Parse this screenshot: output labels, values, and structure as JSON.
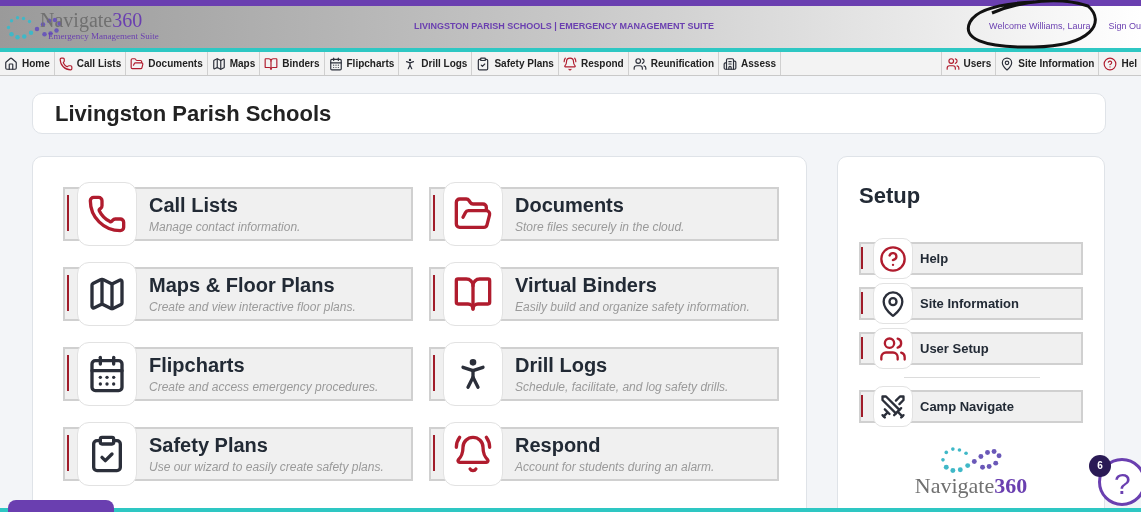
{
  "header": {
    "logo_text": "Navigate",
    "logo_number": "360",
    "logo_subtitle": "Emergency Management Suite",
    "title": "LIVINGSTON PARISH SCHOOLS | EMERGENCY MANAGEMENT SUITE",
    "welcome": "Welcome Williams, Laura",
    "sign_out": "Sign Ou"
  },
  "nav_left": [
    {
      "label": "Home",
      "kind": "home"
    },
    {
      "label": "Call Lists",
      "kind": "calllist"
    },
    {
      "label": "Documents",
      "kind": "documents"
    },
    {
      "label": "Maps",
      "kind": "maps"
    },
    {
      "label": "Binders",
      "kind": "binders"
    },
    {
      "label": "Flipcharts",
      "kind": "flipcharts"
    },
    {
      "label": "Drill Logs",
      "kind": "drill"
    },
    {
      "label": "Safety Plans",
      "kind": "safety"
    },
    {
      "label": "Respond",
      "kind": "respond"
    },
    {
      "label": "Reunification",
      "kind": "reunification"
    },
    {
      "label": "Assess",
      "kind": "assess"
    }
  ],
  "nav_right": [
    {
      "label": "Users",
      "kind": "users"
    },
    {
      "label": "Site Information",
      "kind": "site"
    },
    {
      "label": "Hel",
      "kind": "help"
    }
  ],
  "page_title": "Livingston Parish Schools",
  "modules": [
    {
      "title": "Call Lists",
      "description": "Manage contact information.",
      "kind": "calllist"
    },
    {
      "title": "Documents",
      "description": "Store files securely in the cloud.",
      "kind": "documents"
    },
    {
      "title": "Maps & Floor Plans",
      "description": "Create and view interactive floor plans.",
      "kind": "maps"
    },
    {
      "title": "Virtual Binders",
      "description": "Easily build and organize safety information.",
      "kind": "binders"
    },
    {
      "title": "Flipcharts",
      "description": "Create and access emergency procedures.",
      "kind": "flipcharts"
    },
    {
      "title": "Drill Logs",
      "description": "Schedule, facilitate, and log safety drills.",
      "kind": "drill"
    },
    {
      "title": "Safety Plans",
      "description": "Use our wizard to easily create safety plans.",
      "kind": "safety"
    },
    {
      "title": "Respond",
      "description": "Account for students during an alarm.",
      "kind": "respond"
    }
  ],
  "setup": {
    "title": "Setup",
    "items": [
      {
        "label": "Help",
        "kind": "help"
      },
      {
        "label": "Site Information",
        "kind": "site"
      },
      {
        "label": "User Setup",
        "kind": "users"
      }
    ],
    "extra_items": [
      {
        "label": "Camp Navigate",
        "kind": "camp"
      }
    ],
    "logo_text": "Navigate",
    "logo_number": "360"
  },
  "help_bubble": {
    "badge": "6",
    "symbol": "?"
  }
}
